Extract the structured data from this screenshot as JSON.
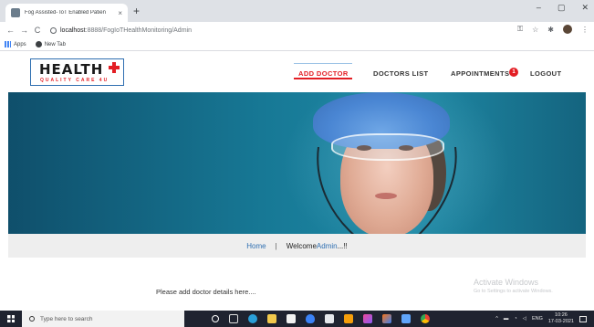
{
  "browser": {
    "tab_title": "Fog Assisted- IoT Enabled Patien",
    "tab_close": "×",
    "new_tab": "+",
    "url_host": "localhost",
    "url_path": ":8888/FogIoTHealthMonitoring/Admin",
    "bookmarks": [
      {
        "label": "Apps",
        "icon": "apps-icon"
      },
      {
        "label": "New Tab",
        "icon": "globe-icon"
      }
    ],
    "window_controls": [
      "–",
      "▢",
      "✕"
    ]
  },
  "site": {
    "logo_word": "HEALTH",
    "logo_tagline": "QUALITY CARE 4U",
    "nav": {
      "add_doctor": "ADD DOCTOR",
      "doctors_list": "DOCTORS LIST",
      "appointments": "APPOINTMENTS",
      "appointments_badge": "1",
      "logout": "LOGOUT"
    },
    "breadcrumb": {
      "home": "Home",
      "separator": "|",
      "welcome": "Welcome ",
      "user": "Admin",
      "suffix": "...!!"
    },
    "add_details_text": "Please add doctor details here....",
    "accent_color": "#e31e24",
    "link_color": "#2f6fb1"
  },
  "watermark": {
    "title": "Activate Windows",
    "subtitle": "Go to Settings to activate Windows."
  },
  "taskbar": {
    "search_placeholder": "Type here to search",
    "language": "ENG",
    "time": "10:26",
    "date": "17-03-2021",
    "pinned_icons": [
      "cortana-icon",
      "task-view-icon",
      "edge-icon",
      "file-explorer-icon",
      "store-icon",
      "security-icon",
      "mail-icon",
      "app-icon",
      "paint-icon",
      "tool-icon",
      "calendar-icon",
      "chrome-icon"
    ]
  }
}
